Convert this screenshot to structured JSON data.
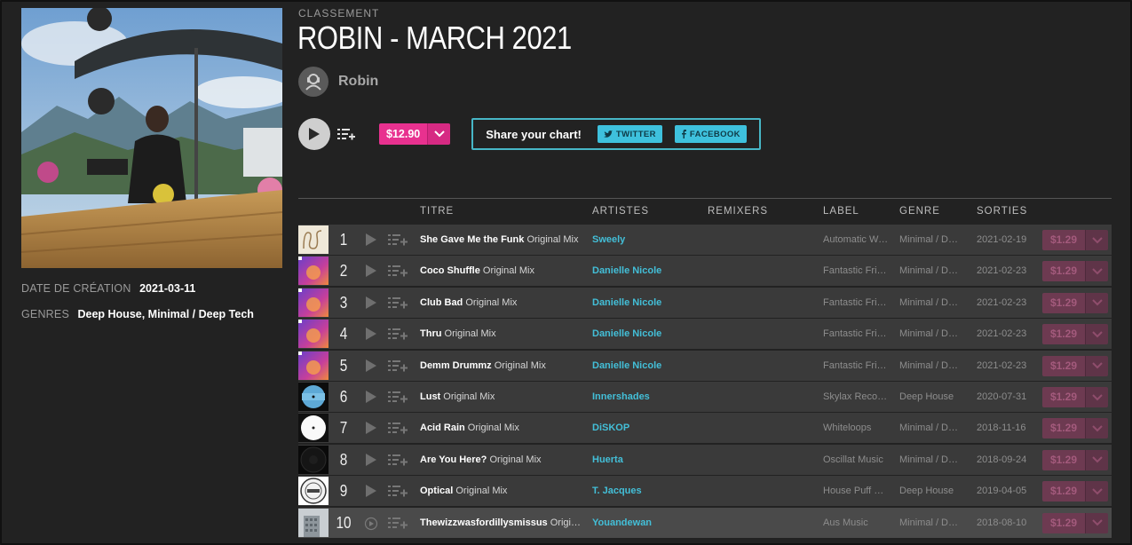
{
  "page": {
    "eyebrow": "CLASSEMENT",
    "title": "ROBIN - MARCH 2021"
  },
  "curator": {
    "name": "Robin",
    "icon": "user-avatar-icon"
  },
  "meta": {
    "created_label": "DATE DE CRÉATION",
    "created_value": "2021-03-11",
    "genres_label": "GENRES",
    "genres_value": "Deep House, Minimal / Deep Tech"
  },
  "controls": {
    "price": "$12.90",
    "share_label": "Share your chart!",
    "twitter": "TWITTER",
    "facebook": "FACEBOOK"
  },
  "columns": {
    "title": "TITRE",
    "artists": "ARTISTES",
    "remixers": "REMIXERS",
    "label": "LABEL",
    "genre": "GENRE",
    "release": "SORTIES"
  },
  "colors": {
    "accent_pink": "#e8318f",
    "accent_cyan": "#43bfd8",
    "background": "#222222",
    "row": "#3a3a3a"
  },
  "tracks": [
    {
      "num": "1",
      "name": "She Gave Me the Funk",
      "mix": "Original Mix",
      "artist": "Sweely",
      "remixer": "",
      "label": "Automatic Writing",
      "genre": "Minimal / Deep Tech",
      "date": "2021-02-19",
      "price": "$1.29",
      "art": "squiggle"
    },
    {
      "num": "2",
      "name": "Coco Shuffle",
      "mix": "Original Mix",
      "artist": "Danielle Nicole",
      "remixer": "",
      "label": "Fantastic Friends",
      "genre": "Minimal / Deep Tech",
      "date": "2021-02-23",
      "price": "$1.29",
      "art": "purple"
    },
    {
      "num": "3",
      "name": "Club Bad",
      "mix": "Original Mix",
      "artist": "Danielle Nicole",
      "remixer": "",
      "label": "Fantastic Friends",
      "genre": "Minimal / Deep Tech",
      "date": "2021-02-23",
      "price": "$1.29",
      "art": "purple"
    },
    {
      "num": "4",
      "name": "Thru",
      "mix": "Original Mix",
      "artist": "Danielle Nicole",
      "remixer": "",
      "label": "Fantastic Friends",
      "genre": "Minimal / Deep Tech",
      "date": "2021-02-23",
      "price": "$1.29",
      "art": "purple"
    },
    {
      "num": "5",
      "name": "Demm Drummz",
      "mix": "Original Mix",
      "artist": "Danielle Nicole",
      "remixer": "",
      "label": "Fantastic Friends",
      "genre": "Minimal / Deep Tech",
      "date": "2021-02-23",
      "price": "$1.29",
      "art": "purple"
    },
    {
      "num": "6",
      "name": "Lust",
      "mix": "Original Mix",
      "artist": "Innershades",
      "remixer": "",
      "label": "Skylax Records",
      "genre": "Deep House",
      "date": "2020-07-31",
      "price": "$1.29",
      "art": "vinyl-blue"
    },
    {
      "num": "7",
      "name": "Acid Rain",
      "mix": "Original Mix",
      "artist": "DiSKOP",
      "remixer": "",
      "label": "Whiteloops",
      "genre": "Minimal / Deep Tech",
      "date": "2018-11-16",
      "price": "$1.29",
      "art": "vinyl-white"
    },
    {
      "num": "8",
      "name": "Are You Here?",
      "mix": "Original Mix",
      "artist": "Huerta",
      "remixer": "",
      "label": "Oscillat Music",
      "genre": "Minimal / Deep Tech",
      "date": "2018-09-24",
      "price": "$1.29",
      "art": "vinyl-dark"
    },
    {
      "num": "9",
      "name": "Optical",
      "mix": "Original Mix",
      "artist": "T. Jacques",
      "remixer": "",
      "label": "House Puff Records",
      "genre": "Deep House",
      "date": "2019-04-05",
      "price": "$1.29",
      "art": "vinyl-stamp"
    },
    {
      "num": "10",
      "name": "Thewizzwasfordillysmissus",
      "mix": "Original Mix",
      "artist": "Youandewan",
      "remixer": "",
      "label": "Aus Music",
      "genre": "Minimal / Deep Tech",
      "date": "2018-08-10",
      "price": "$1.29",
      "art": "building"
    }
  ]
}
